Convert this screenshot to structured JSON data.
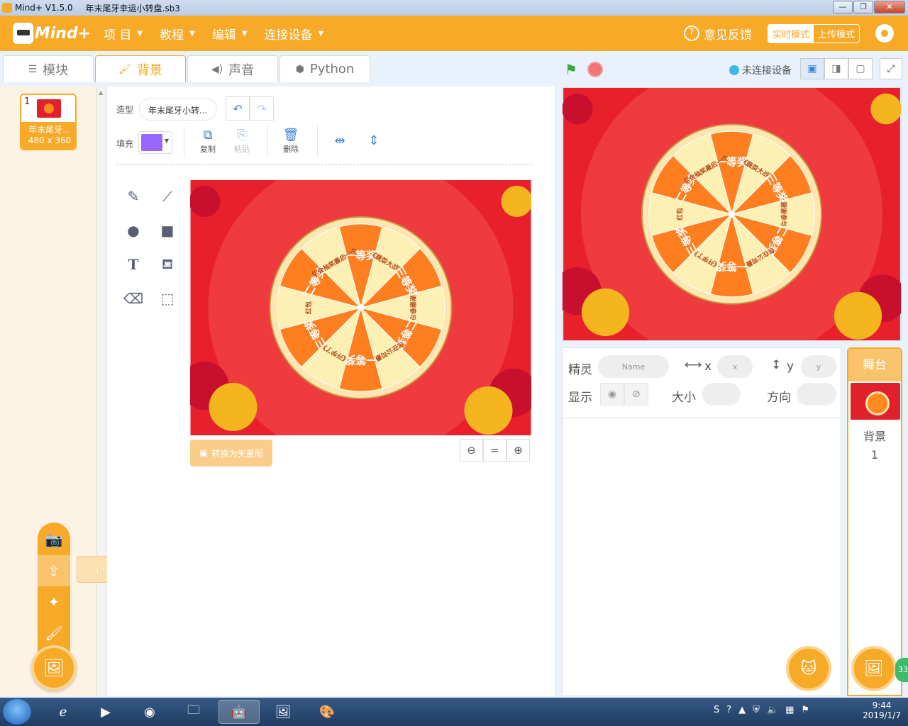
{
  "window": {
    "app_name": "Mind+ V1.5.0",
    "file_name": "年末尾牙幸运小转盘.sb3"
  },
  "menubar": {
    "logo": "Mind+",
    "items": [
      "项 目",
      "教程",
      "编辑",
      "连接设备"
    ],
    "feedback": "意见反馈",
    "mode_realtime": "实时模式",
    "mode_upload": "上传模式"
  },
  "tabs": [
    "模块",
    "背景",
    "声音",
    "Python"
  ],
  "stage_header": {
    "connection": "未连接设备"
  },
  "costume": {
    "number": "1",
    "name": "年末尾牙...",
    "size": "480 x 360"
  },
  "editor": {
    "costume_label": "造型",
    "costume_name": "年末尾牙小转...",
    "fill_label": "填充",
    "fill_color": "#9966ff",
    "copy": "复制",
    "paste": "粘贴",
    "delete": "删除",
    "convert": "转换为矢量图",
    "zoom_reset": "="
  },
  "upload_tooltip": "上传背景",
  "wheel": {
    "colors": {
      "orange": "#ff7e1f",
      "cream": "#fdf0b5",
      "bg": "#e8202c"
    },
    "segments": [
      "一等奖",
      "《蔬菜大战》",
      "三等奖",
      "谢谢参与",
      "二等奖",
      "包在公司最后",
      "一等奖",
      "《开学了》",
      "三等奖",
      "红包",
      "二等奖",
      "年会抽奖最后一个"
    ]
  },
  "sprite_info": {
    "sprite_label": "精灵",
    "name_placeholder": "Name",
    "x_label": "x",
    "x_placeholder": "x",
    "y_label": "y",
    "y_placeholder": "y",
    "show_label": "显示",
    "size_label": "大小",
    "direction_label": "方向"
  },
  "stage_panel": {
    "title": "舞台",
    "backdrop_label": "背景",
    "backdrop_count": "1",
    "badge": "33"
  },
  "taskbar": {
    "time": "9:44",
    "date": "2019/1/7"
  }
}
